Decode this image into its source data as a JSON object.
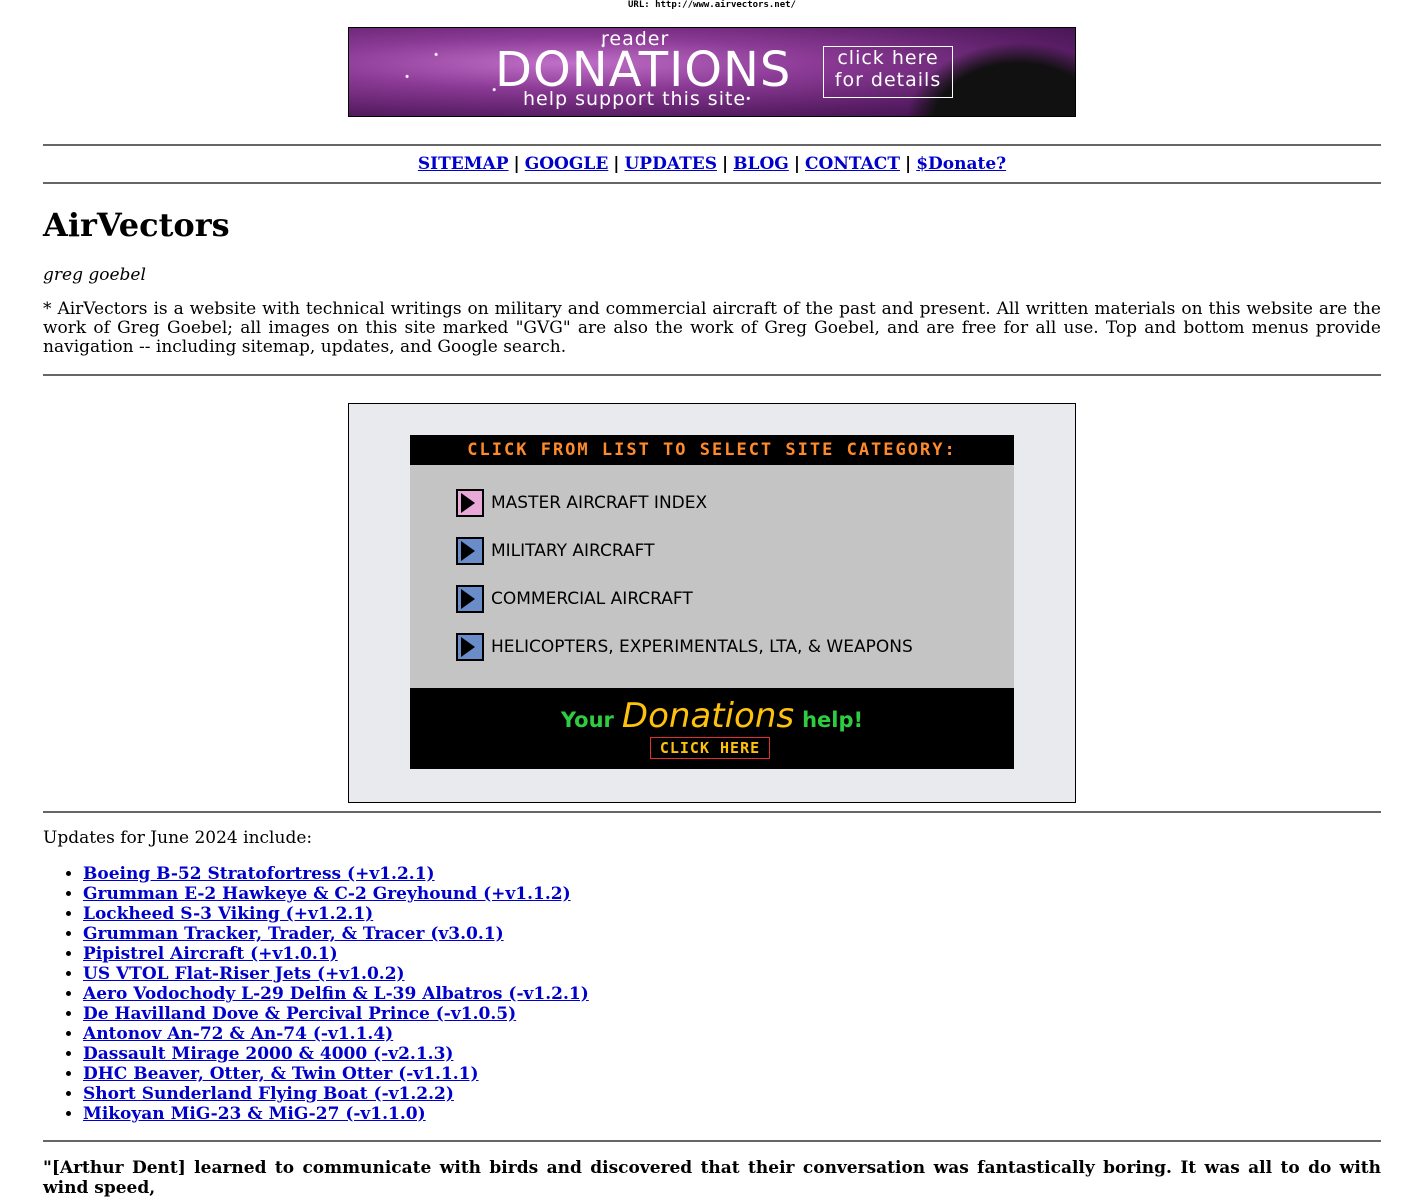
{
  "url_bar": "URL: http://www.airvectors.net/",
  "banner": {
    "reader": "reader",
    "title": "DONATIONS",
    "subtitle": "help support this site",
    "click_line1": "click here",
    "click_line2": "for details"
  },
  "nav": {
    "items": [
      "SITEMAP",
      "GOOGLE",
      "UPDATES",
      "BLOG",
      "CONTACT",
      "$Donate?"
    ],
    "separator": "|"
  },
  "page_title": "AirVectors",
  "author": "greg goebel",
  "intro": "* AirVectors is a website with technical writings on military and commercial aircraft of the past and present. All written materials on this website are the work of Greg Goebel; all images on this site marked \"GVG\" are also the work of Greg Goebel, and are free for all use. Top and bottom menus provide navigation -- including sitemap, updates, and Google search.",
  "category_menu": {
    "header": "CLICK FROM LIST TO SELECT SITE CATEGORY:",
    "items": [
      {
        "label": "MASTER AIRCRAFT INDEX",
        "color": "#e8a8d8"
      },
      {
        "label": "MILITARY AIRCRAFT",
        "color": "#6a8cc8"
      },
      {
        "label": "COMMERCIAL AIRCRAFT",
        "color": "#6a8cc8"
      },
      {
        "label": "HELICOPTERS, EXPERIMENTALS, LTA, & WEAPONS",
        "color": "#6a8cc8"
      }
    ],
    "donations": {
      "your": "Your",
      "word": "Donations",
      "help": "help!",
      "button": "CLICK HERE"
    }
  },
  "updates": {
    "heading": "Updates for June 2024 include:",
    "items": [
      "Boeing B-52 Stratofortress (+v1.2.1)",
      "Grumman E-2 Hawkeye & C-2 Greyhound (+v1.1.2)",
      "Lockheed S-3 Viking (+v1.2.1)",
      "Grumman Tracker, Trader, & Tracer (v3.0.1)",
      "Pipistrel Aircraft (+v1.0.1)",
      "US VTOL Flat-Riser Jets (+v1.0.2)",
      "Aero Vodochody L-29 Delfin & L-39 Albatros (-v1.2.1)",
      "De Havilland Dove & Percival Prince (-v1.0.5)",
      "Antonov An-72 & An-74 (-v1.1.4)",
      "Dassault Mirage 2000 & 4000 (-v2.1.3)",
      "DHC Beaver, Otter, & Twin Otter (-v1.1.1)",
      "Short Sunderland Flying Boat (-v1.2.2)",
      "Mikoyan MiG-23 & MiG-27 (-v1.1.0)"
    ]
  },
  "quote": "\"[Arthur Dent] learned to communicate with birds and discovered that their conversation was fantastically boring. It was all to do with wind speed,"
}
